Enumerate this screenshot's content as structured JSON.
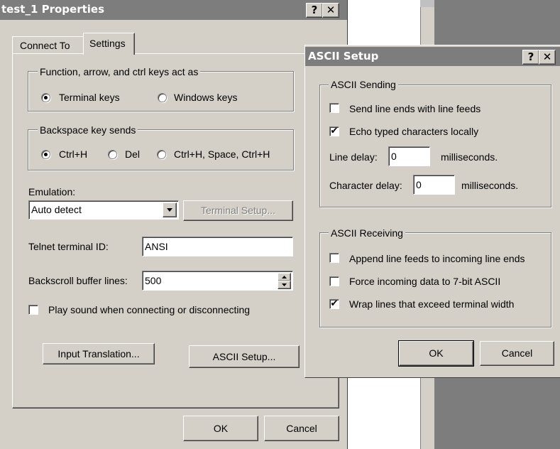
{
  "background_window": {
    "title": "test_1 Properties",
    "help_btn": "?",
    "close_btn": "✕",
    "tabs": [
      {
        "label": "Connect To",
        "active": false
      },
      {
        "label": "Settings",
        "active": true
      }
    ],
    "function_keys_group": {
      "legend": "Function, arrow, and ctrl keys act as",
      "options": [
        {
          "label": "Terminal keys",
          "selected": true
        },
        {
          "label": "Windows keys",
          "selected": false
        }
      ]
    },
    "backspace_group": {
      "legend": "Backspace key sends",
      "options": [
        {
          "label": "Ctrl+H",
          "selected": true
        },
        {
          "label": "Del",
          "selected": false
        },
        {
          "label": "Ctrl+H, Space, Ctrl+H",
          "selected": false
        }
      ]
    },
    "emulation": {
      "label": "Emulation:",
      "value": "Auto detect",
      "terminal_setup_label": "Terminal Setup..."
    },
    "telnet_id": {
      "label": "Telnet terminal ID:",
      "value": "ANSI"
    },
    "backscroll": {
      "label": "Backscroll buffer lines:",
      "value": "500"
    },
    "play_sound": {
      "label": "Play sound when connecting or disconnecting",
      "checked": false
    },
    "input_translation_label": "Input Translation...",
    "ascii_setup_label": "ASCII Setup...",
    "ok_label": "OK",
    "cancel_label": "Cancel"
  },
  "ascii_dialog": {
    "title": "ASCII Setup",
    "help_btn": "?",
    "close_btn": "✕",
    "sending": {
      "legend": "ASCII Sending",
      "send_line_ends": {
        "label": "Send line ends with line feeds",
        "checked": false
      },
      "echo_typed": {
        "label": "Echo typed characters locally",
        "checked": true
      },
      "line_delay": {
        "label": "Line delay:",
        "value": "0",
        "unit": "milliseconds."
      },
      "char_delay": {
        "label": "Character delay:",
        "value": "0",
        "unit": "milliseconds."
      }
    },
    "receiving": {
      "legend": "ASCII Receiving",
      "append_line_feeds": {
        "label": "Append line feeds to incoming line ends",
        "checked": false
      },
      "force_7bit": {
        "label": "Force incoming data to 7-bit ASCII",
        "checked": false
      },
      "wrap_lines": {
        "label": "Wrap lines that exceed terminal width",
        "checked": true
      }
    },
    "ok_label": "OK",
    "cancel_label": "Cancel"
  },
  "check_mark": "✔"
}
